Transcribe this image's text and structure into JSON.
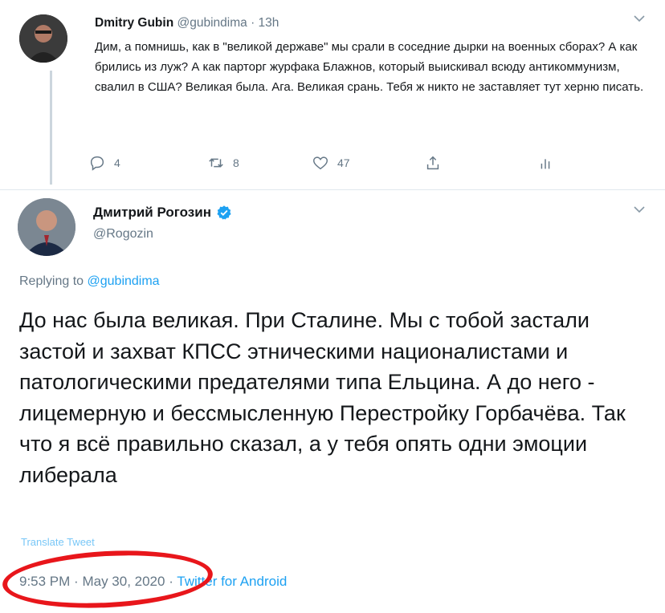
{
  "parent_tweet": {
    "author_name": "Dmitry Gubin",
    "author_handle": "@gubindima",
    "separator": "·",
    "time": "13h",
    "text": "Дим, а помнишь, как в \"великой державе\" мы срали в соседние дырки на военных сборах? А как брились из луж? А как парторг журфака Блажнов, который выискивал всюду антикоммунизм, свалил в США? Великая была. Ага. Великая срань. Тебя ж никто не заставляет тут херню писать.",
    "actions": {
      "reply_count": "4",
      "retweet_count": "8",
      "like_count": "47"
    },
    "icons": [
      "reply-icon",
      "retweet-icon",
      "like-icon",
      "share-icon",
      "analytics-icon",
      "chevron-down-icon"
    ]
  },
  "main_tweet": {
    "author_name": "Дмитрий Рогозин",
    "author_handle": "@Rogozin",
    "verified": true,
    "replying_prefix": "Replying to",
    "replying_to": "@gubindima",
    "text": "До нас была великая. При Сталине. Мы с тобой застали застой и захват КПСС этническими националистами и патологическими предателями типа Ельцина. А до него - лицемерную и бессмысленную Перестройку Горбачёва. Так что я всё правильно сказал, а у тебя опять одни эмоции либерала",
    "translate_label": "Translate Tweet",
    "time": "9:53 PM",
    "separator": "·",
    "date": "May 30, 2020",
    "source": "Twitter for Android"
  },
  "colors": {
    "accent": "#1da1f2",
    "secondary_text": "#657786",
    "annotation": "#e8161b"
  }
}
